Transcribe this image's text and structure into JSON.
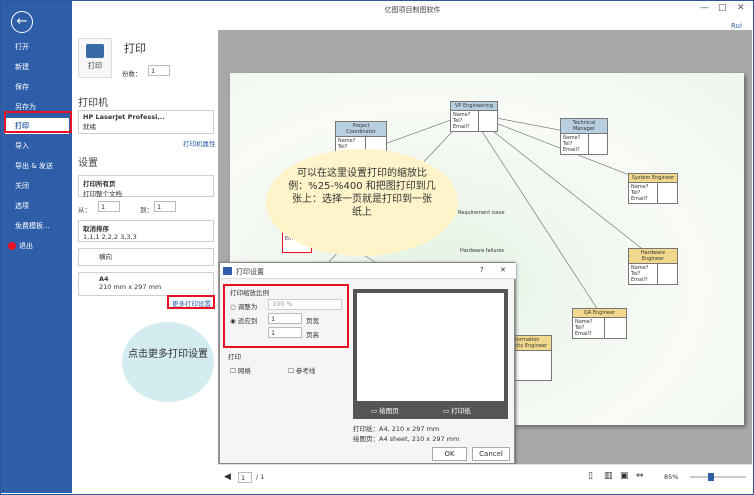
{
  "app": {
    "title": "亿图项目制图软件",
    "user": "Rui",
    "win_min": "—",
    "win_max": "□",
    "win_close": "✕"
  },
  "sidebar": {
    "items": [
      "打开",
      "新建",
      "保存",
      "另存为",
      "打印",
      "导入",
      "导出 & 发送",
      "关闭",
      "选项",
      "免费模板...",
      "退出"
    ]
  },
  "print": {
    "heading": "打印",
    "button": "打印",
    "copies_label": "份数：",
    "copies": "1"
  },
  "printer": {
    "heading": "打印机",
    "name": "HP LaserJet Professi...",
    "status": "就绪",
    "props_link": "打印机属性"
  },
  "settings": {
    "heading": "设置",
    "range_title": "打印所有页",
    "range_sub": "打印整个文档",
    "from_label": "从：",
    "from": "1",
    "to_label": "到：",
    "to": "1",
    "collate_title": "取消排序",
    "collate_sub": "1,1,1  2,2,2  3,3,3",
    "orientation": "横向",
    "paper": "A4",
    "paper_size": "210 mm x 297 mm",
    "more_link": "更多打印设置..."
  },
  "diagram": {
    "boxes": [
      {
        "title": "Project Coordinator",
        "fields": "Name?\nTel?"
      },
      {
        "title": "VP Engineering",
        "fields": "Name?\nTel?\nEmail?"
      },
      {
        "title": "Technical Manager",
        "fields": "Name?\nTel?\nEmail?"
      },
      {
        "title": "System Engineer",
        "fields": "Name?\nTel?\nEmail?"
      },
      {
        "title": "Hardware Engineer",
        "fields": "Name?\nTel?\nEmail?"
      },
      {
        "title": "QA Engineer",
        "fields": "Name?\nTel?\nEmail?"
      },
      {
        "title": "Information Security Engineer",
        "fields": ""
      },
      {
        "title": "",
        "fields": "Name?\nTel?\nEmail?"
      }
    ],
    "labels": [
      "Requirement issue",
      "Hardware failures"
    ]
  },
  "callout": {
    "text": "可以在这里设置打印的缩放比例：%25-%400 和把图打印到几张上：选择一页就是打印到一张纸上"
  },
  "dialog": {
    "title": "打印设置",
    "help": "?",
    "close": "✕",
    "scale_section": "打印缩放比例",
    "adjust_label": "调整为",
    "adjust_value": "100 %",
    "fit_label": "适应到",
    "fit_w": "1",
    "fit_h": "1",
    "pages_label": "页宽",
    "pages_label2": "页高",
    "print_section": "打印",
    "grid_label": "网格",
    "guides_label": "参考线",
    "legend_page": "绘图页",
    "legend_paper": "打印纸",
    "paper_info": "打印纸：A4, 210 x 297 mm",
    "page_info": "绘图页：A4 sheet, 210 x 297 mm",
    "ok": "OK",
    "cancel": "Cancel"
  },
  "speech": {
    "text": "点击更多打印设置"
  },
  "statusbar": {
    "page": "1",
    "total": "/ 1",
    "zoom": "85%"
  }
}
